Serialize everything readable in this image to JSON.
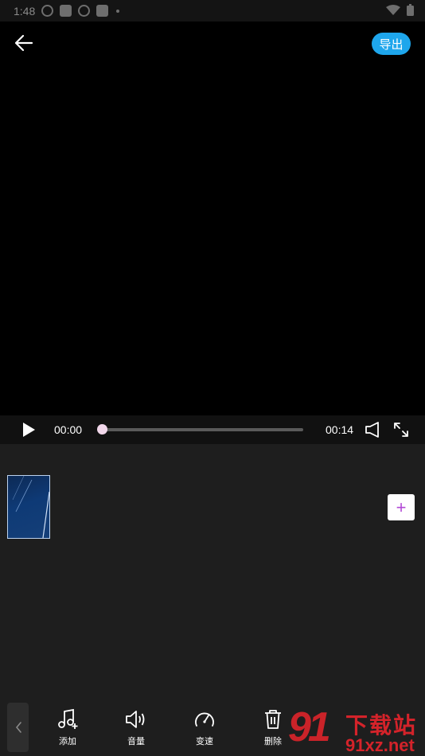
{
  "status_bar": {
    "time": "1:48",
    "icons": [
      "sync-icon",
      "app-icon",
      "sync-icon",
      "app-icon",
      "dot-icon"
    ],
    "right_icons": [
      "wifi-icon",
      "battery-icon"
    ]
  },
  "header": {
    "back_icon": "arrow-left-icon",
    "export_label": "导出"
  },
  "player": {
    "current_time": "00:00",
    "total_time": "00:14",
    "progress": 0,
    "play_icon": "play-icon",
    "volume_icon": "speaker-icon",
    "fullscreen_icon": "expand-icon"
  },
  "timeline": {
    "add_label": "+"
  },
  "toolbar": {
    "items": [
      {
        "label": "添加",
        "icon": "music-add-icon"
      },
      {
        "label": "音量",
        "icon": "volume-icon"
      },
      {
        "label": "变速",
        "icon": "speedometer-icon"
      },
      {
        "label": "删除",
        "icon": "trash-icon"
      }
    ]
  },
  "watermark": {
    "big": "91",
    "top": "下载站",
    "bottom": "91xz.net"
  },
  "colors": {
    "accent": "#1ea6ec",
    "add_icon": "#b34ad6",
    "watermark": "#e8242c"
  }
}
